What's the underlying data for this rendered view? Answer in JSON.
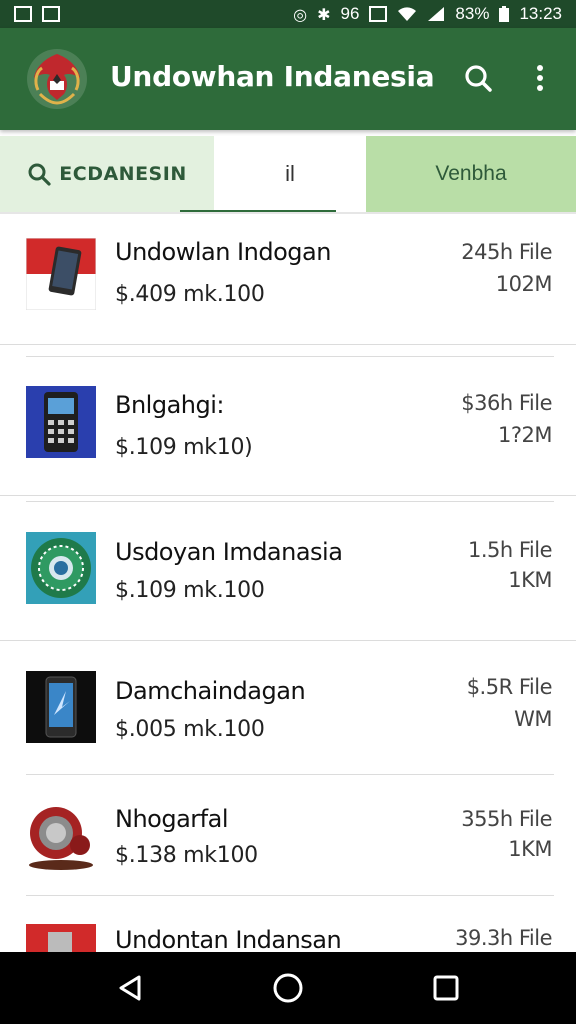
{
  "status_bar": {
    "battery": "83%",
    "time": "13:23",
    "signal_text": "96",
    "icons": [
      "image-icon",
      "mail-icon",
      "nfc-icon",
      "bluetooth-icon",
      "vibrate-icon",
      "wifi-icon",
      "signal-icon",
      "battery-icon"
    ]
  },
  "app_bar": {
    "title": "Undowhan Indanesia",
    "search_icon": "search-icon",
    "menu_icon": "more-vert-icon"
  },
  "tabs": [
    {
      "label": "ECDANESIN",
      "icon": "search-icon",
      "selected": false
    },
    {
      "label": "il",
      "selected": true
    },
    {
      "label": "Venbha",
      "selected": false
    }
  ],
  "items": [
    {
      "title": "Undowlan Indogan",
      "price": "$.409 mk.100",
      "size": "245h File",
      "downloads": "102M",
      "icon": "flag-phone-icon"
    },
    {
      "title": "Bnlgahgi:",
      "price": "$.109 mk10)",
      "size": "$36h File",
      "downloads": "1?2M",
      "icon": "feature-phone-icon"
    },
    {
      "title": "Usdoyan Imdanasia",
      "price": "$.109 mk.100",
      "size": "1.5h File",
      "downloads": "1KM",
      "icon": "emblem-icon"
    },
    {
      "title": "Damchaindagan",
      "price": "$.005 mk.100",
      "size": "$.5R File",
      "downloads": "WM",
      "icon": "smartphone-icon"
    },
    {
      "title": "Nhogarfal",
      "price": "$.138 mk100",
      "size": "355h File",
      "downloads": "1KM",
      "icon": "speaker-icon"
    },
    {
      "title": "Undontan Indansan",
      "price": "",
      "size": "39.3h File",
      "downloads": "",
      "icon": "flag-icon"
    }
  ],
  "colors": {
    "app_bar": "#2e6b3a",
    "status_bar": "#1f4a2a",
    "tab_light": "#e3f1df",
    "tab_accent": "#b9dea7"
  }
}
